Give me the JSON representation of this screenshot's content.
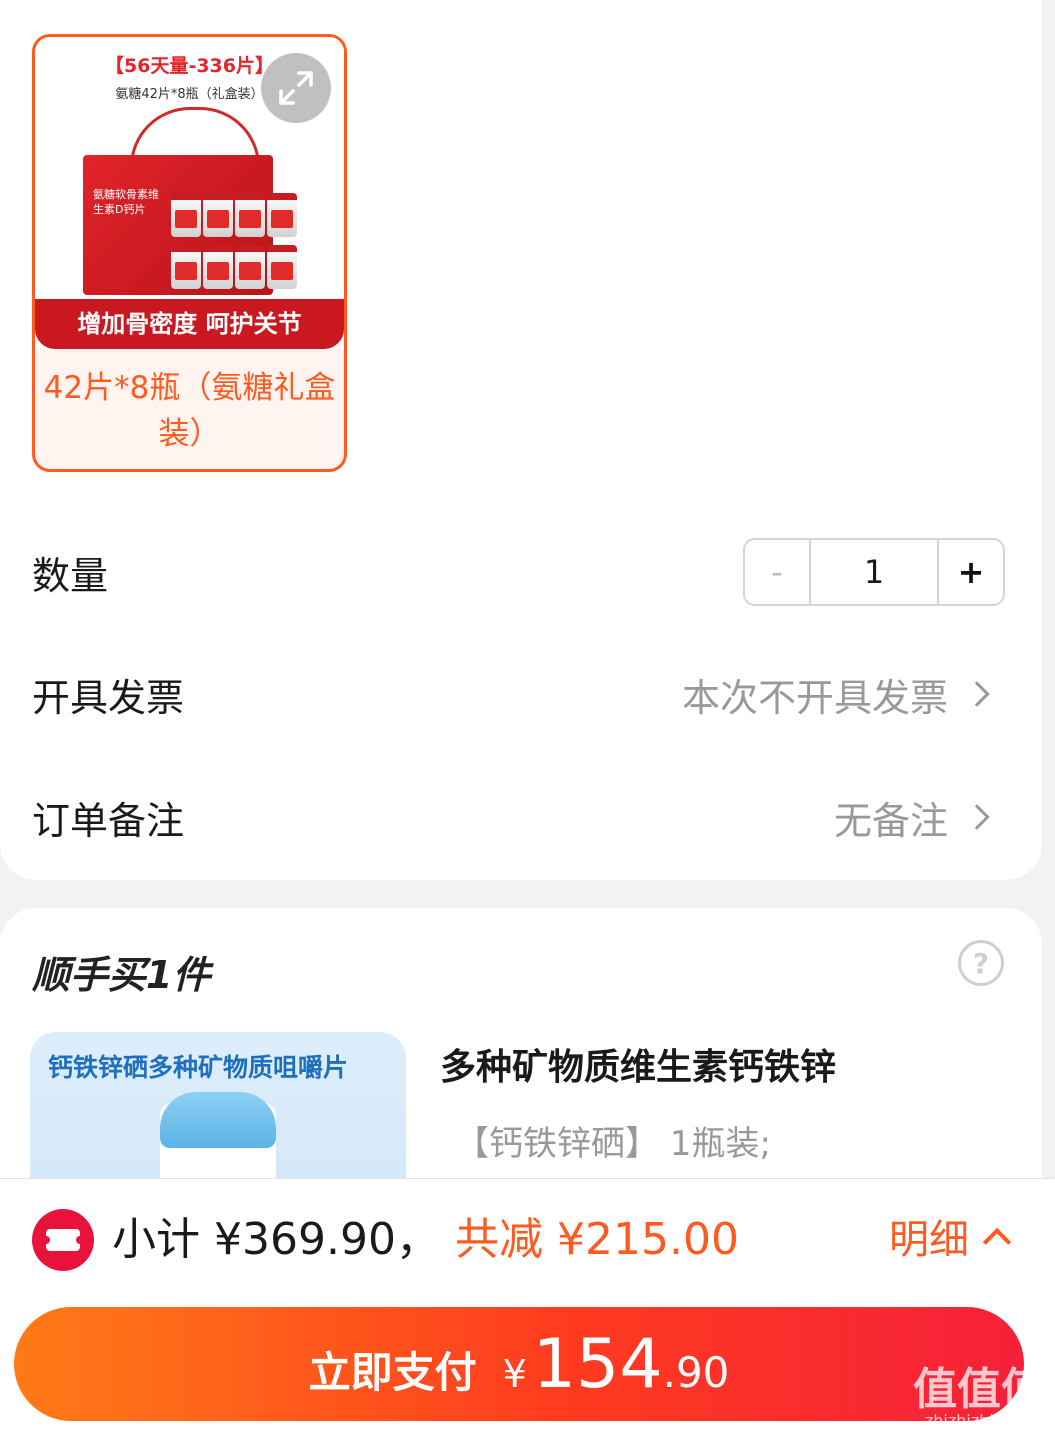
{
  "sku": {
    "banner_title": "【56天量-336片】",
    "banner_sub": "氨糖42片*8瓶（礼盒装）",
    "box_text": "氨糖软骨素维生素D钙片",
    "slogan": "增加骨密度  呵护关节",
    "name": "42片*8瓶（氨糖礼盒装）"
  },
  "quantity": {
    "label": "数量",
    "value": "1",
    "minus": "-",
    "plus": "+"
  },
  "invoice": {
    "label": "开具发票",
    "value": "本次不开具发票"
  },
  "remark": {
    "label": "订单备注",
    "value": "无备注"
  },
  "addon": {
    "title": "顺手买1件",
    "help": "?",
    "image_title": "钙铁锌硒多种矿物质咀嚼片",
    "name": "多种矿物质维生素钙铁锌",
    "spec": "【钙铁锌硒】 1瓶装;"
  },
  "summary": {
    "subtotal": "小计 ¥369.90，",
    "discount": "共减 ¥215.00",
    "detail": "明细"
  },
  "pay": {
    "label": "立即支付",
    "yen": "¥",
    "int": "154",
    "dec": ".90"
  },
  "watermark": {
    "big": "值值值",
    "url": "zhizhizhi.com"
  },
  "colors": {
    "accent": "#ff5a1f",
    "coupon": "#e8123a"
  }
}
